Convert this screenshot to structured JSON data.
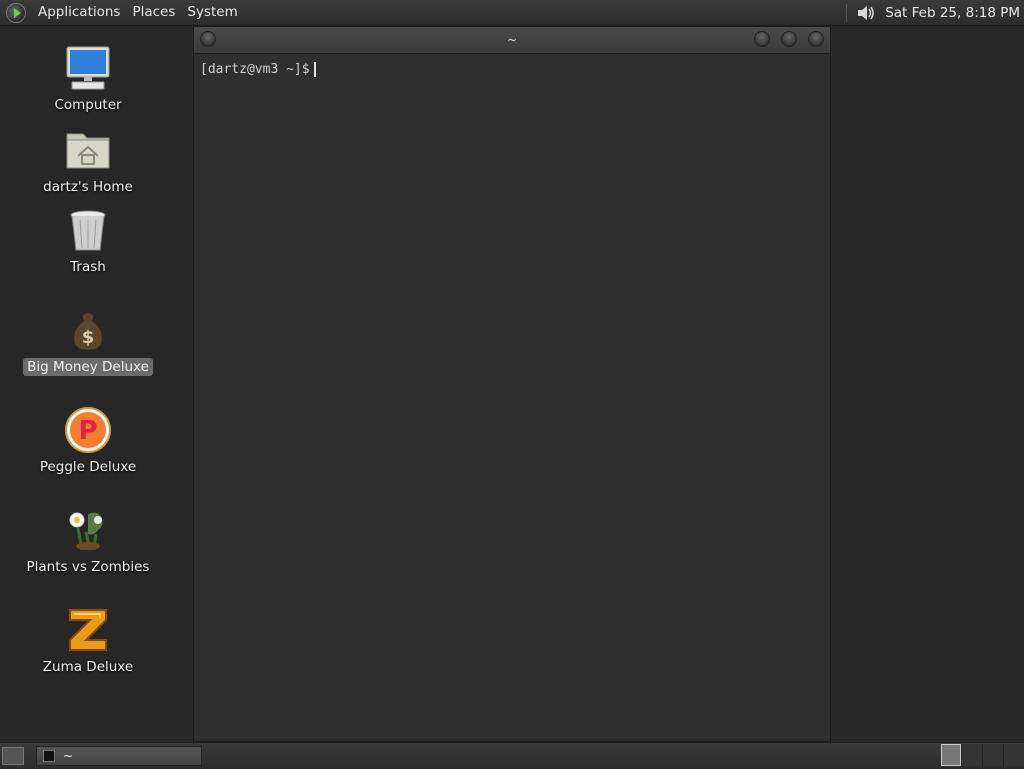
{
  "top_panel": {
    "menus": [
      "Applications",
      "Places",
      "System"
    ],
    "clock": "Sat Feb 25,  8:18 PM"
  },
  "desktop_icons": [
    {
      "label": "Computer",
      "icon": "computer-icon"
    },
    {
      "label": "dartz's Home",
      "icon": "home-folder-icon"
    },
    {
      "label": "Trash",
      "icon": "trash-icon"
    },
    {
      "label": "Big Money Deluxe",
      "icon": "money-bag-icon",
      "selected": true
    },
    {
      "label": "Peggle Deluxe",
      "icon": "peggle-icon"
    },
    {
      "label": "Plants vs Zombies",
      "icon": "plants-vs-zombies-icon"
    },
    {
      "label": "Zuma Deluxe",
      "icon": "zuma-icon"
    }
  ],
  "terminal": {
    "title": "~",
    "prompt": "[dartz@vm3 ~]$"
  },
  "taskbar": {
    "tasks": [
      {
        "label": "~",
        "icon": "terminal-icon"
      }
    ],
    "workspaces": 4,
    "active_workspace": 1
  },
  "colors": {
    "panel": "#333333",
    "terminal_bg": "#2f2f2f",
    "selection": "#6b6b6b",
    "accent": "#7ac943"
  }
}
